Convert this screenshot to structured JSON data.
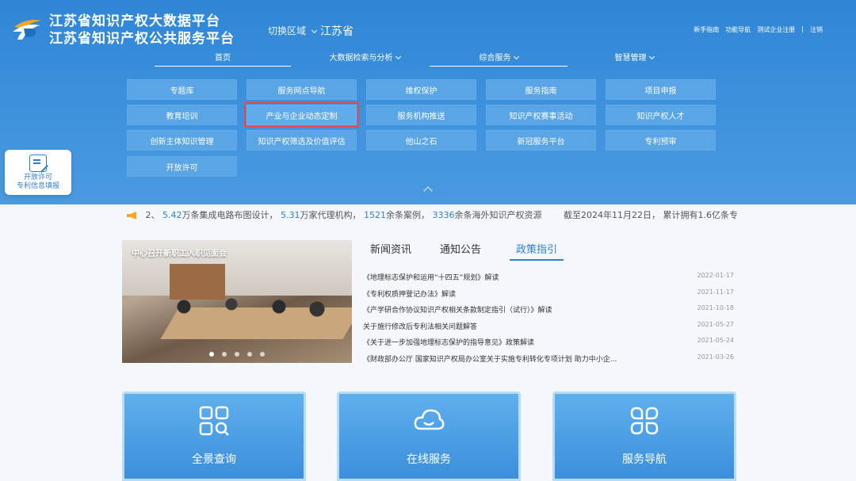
{
  "brand": {
    "line1": "江苏省知识产权大数据平台",
    "line2": "江苏省知识产权公共服务平台"
  },
  "region": {
    "switch_label": "切换区域",
    "current": "江苏省"
  },
  "top_links": [
    "新手指南",
    "功能导航",
    "测试企业注册",
    "|",
    "注销"
  ],
  "nav": [
    "首页",
    "大数据检索与分析",
    "综合服务",
    "智慧管理"
  ],
  "menu": [
    [
      "专题库",
      "服务网点导航",
      "维权保护",
      "服务指南",
      "项目申报"
    ],
    [
      "教育培训",
      "产业与企业动态定制",
      "服务机构推送",
      "知识产权赛事活动",
      "知识产权人才"
    ],
    [
      "创新主体知识管理",
      "知识产权筛选及价值评估",
      "他山之石",
      "新冠服务平台",
      "专利预审"
    ],
    [
      "开放许可"
    ]
  ],
  "float_card": {
    "line1": "开放许可",
    "line2": "专利信息填报"
  },
  "ticker": {
    "p1": "2、",
    "n1": "5.42",
    "t1": "万条集成电路布图设计，",
    "n2": "5.31",
    "t2": "万家代理机构，",
    "n3": "1521",
    "t3": "余条案例，",
    "n4": "3336",
    "t4": "余条海外知识产权资源",
    "t5": "截至2024年11月22日，  累计拥有1.6亿条专利"
  },
  "banner": {
    "title": "中心召开新职工入职见面会"
  },
  "tabs": [
    "新闻资讯",
    "通知公告",
    "政策指引"
  ],
  "news": [
    {
      "title": "《地理标志保护和运用“十四五”规划》解读",
      "date": "2022-01-17"
    },
    {
      "title": "《专利权质押登记办法》解读",
      "date": "2021-11-17"
    },
    {
      "title": "《产学研合作协议知识产权相关条款制定指引（试行）》解读",
      "date": "2021-10-18"
    },
    {
      "title": "关于施行修改后专利法相关问题解答",
      "date": "2021-05-27"
    },
    {
      "title": "《关于进一步加强地理标志保护的指导意见》政策解读",
      "date": "2021-05-24"
    },
    {
      "title": "《财政部办公厅 国家知识产权局办公室关于实施专利转化专项计划 助力中小企...",
      "date": "2021-03-26"
    }
  ],
  "services": [
    "全景查询",
    "在线服务",
    "服务导航"
  ]
}
